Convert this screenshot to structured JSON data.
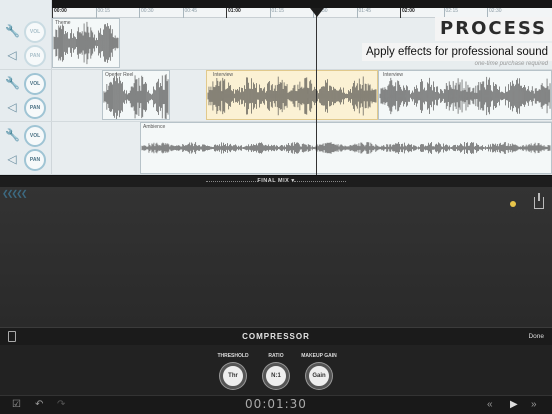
{
  "ruler": {
    "ticks": [
      {
        "label": "00:00",
        "major": true
      },
      {
        "label": "00:15",
        "major": false
      },
      {
        "label": "00:30",
        "major": false
      },
      {
        "label": "00:45",
        "major": false
      },
      {
        "label": "01:00",
        "major": true
      },
      {
        "label": "01:15",
        "major": false
      },
      {
        "label": "01:30",
        "major": false
      },
      {
        "label": "01:45",
        "major": false
      },
      {
        "label": "02:00",
        "major": true
      },
      {
        "label": "02:15",
        "major": false
      },
      {
        "label": "02:30",
        "major": false
      }
    ]
  },
  "tracks": [
    {
      "vol_label": "VOL",
      "pan_label": "PAN",
      "dim": true
    },
    {
      "vol_label": "VOL",
      "pan_label": "PAN",
      "dim": false
    },
    {
      "vol_label": "VOL",
      "pan_label": "PAN",
      "dim": false
    }
  ],
  "clips": {
    "theme": "Theme",
    "opener": "Opener Reel",
    "interview_a": "Interview",
    "interview_b": "Interview",
    "ambience": "Ambience"
  },
  "promo": {
    "title": "PROCESS",
    "subtitle": "Apply effects for professional sound",
    "note": "one-time purchase required"
  },
  "mix": {
    "label": "FINAL MIX ▾"
  },
  "compressor": {
    "title": "COMPRESSOR",
    "done": "Done",
    "params": [
      {
        "label": "THRESHOLD",
        "dial": "Thr"
      },
      {
        "label": "RATIO",
        "dial": "N:1"
      },
      {
        "label": "MAKEUP GAIN",
        "dial": "Gain"
      }
    ]
  },
  "transport": {
    "time": "00:01:30",
    "icons": [
      "edit-icon",
      "undo-icon",
      "redo-icon",
      "rewind-icon",
      "play-icon",
      "fast-forward-icon"
    ]
  },
  "colors": {
    "accent": "#9fc4d4",
    "selected_clip": "#fbf1d4",
    "indicator": "#e8c54a"
  }
}
